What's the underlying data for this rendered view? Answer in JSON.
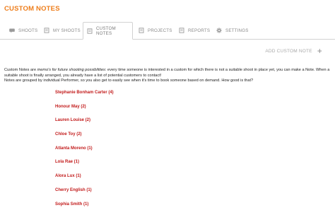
{
  "page": {
    "title": "CUSTOM NOTES"
  },
  "tabs": [
    {
      "label": "SHOOTS",
      "icon": "chat-bubble-icon"
    },
    {
      "label": "MY SHOOTS",
      "icon": "document-icon"
    },
    {
      "label": "CUSTOM NOTES",
      "icon": "document-icon",
      "active": true
    },
    {
      "label": "PROJECTS",
      "icon": "document-icon"
    },
    {
      "label": "REPORTS",
      "icon": "document-icon"
    },
    {
      "label": "SETTINGS",
      "icon": "gear-icon"
    }
  ],
  "actions": {
    "add_custom_note": "ADD CUSTOM NOTE"
  },
  "description": {
    "line1_start": "Custom Notes are ",
    "line1_italic": "memo's for future shooting possibilities",
    "line1_end": ": every time someone is interested in a custom for which there is not a suitable shoot in place yet, you can make a Note. When a suitable shoot is finally arranged, you already have a list of potential customers to contact!",
    "line2": "Notes are grouped by individual Performer, so you also get to easily see when it's time to book someone based on demand. How good is that?"
  },
  "notes": [
    "Stephanie Bonham Carter (4)",
    "Honour May (2)",
    "Lauren Louise (2)",
    "Chloe Toy (2)",
    "Atlanta Moreno (1)",
    "Lola Rae (1)",
    "Alora Lux (1)",
    "Cherry English (1)",
    "Sophia Smith (1)"
  ],
  "colors": {
    "accent": "#ee7d1a",
    "link": "#c21a1a",
    "muted": "#8a8a8a"
  }
}
